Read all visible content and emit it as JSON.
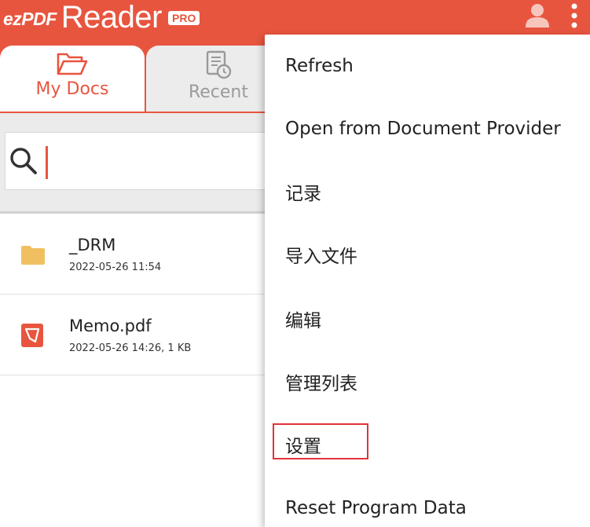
{
  "app": {
    "logo_ez": "ezPDF",
    "logo_reader": "Reader",
    "logo_badge": "PRO"
  },
  "toolbar": {
    "user_icon": "person-icon",
    "more_icon": "more-vert-icon"
  },
  "tabs": [
    {
      "label": "My Docs",
      "icon": "folder-open-icon",
      "selected": true
    },
    {
      "label": "Recent",
      "icon": "recent-document-icon",
      "selected": false
    }
  ],
  "search": {
    "value": "",
    "icon": "search-icon"
  },
  "files": [
    {
      "name": "_DRM",
      "meta": "2022-05-26 11:54",
      "icon": "folder-icon"
    },
    {
      "name": "Memo.pdf",
      "meta": "2022-05-26 14:26, 1 KB",
      "icon": "pdf-file-icon"
    }
  ],
  "menu": {
    "items": [
      {
        "label": "Refresh"
      },
      {
        "label": "Open from Document Provider"
      },
      {
        "label": "记录"
      },
      {
        "label": "导入文件"
      },
      {
        "label": "编辑"
      },
      {
        "label": "管理列表"
      },
      {
        "label": "设置",
        "highlighted": true
      },
      {
        "label": "Reset Program Data"
      }
    ]
  },
  "colors": {
    "brand": "#e8553f",
    "highlight_box": "#e0343a",
    "folder": "#f0c060"
  }
}
